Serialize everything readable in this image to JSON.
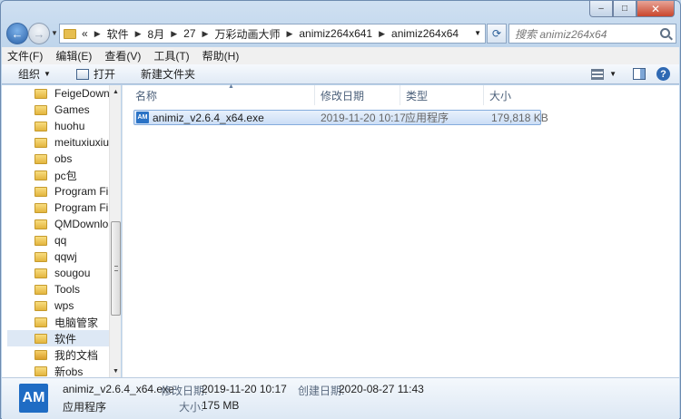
{
  "window": {
    "caption_minimize": "–",
    "caption_maximize": "□",
    "caption_close": "✕"
  },
  "address": {
    "chevron": "«",
    "crumbs": [
      "软件",
      "8月",
      "27",
      "万彩动画大师",
      "animiz264x641",
      "animiz264x64"
    ],
    "search_placeholder": "搜索 animiz264x64"
  },
  "menu": [
    "文件(F)",
    "编辑(E)",
    "查看(V)",
    "工具(T)",
    "帮助(H)"
  ],
  "toolbar": {
    "organize": "组织",
    "open": "打开",
    "new_folder": "新建文件夹",
    "help": "?"
  },
  "navpane": {
    "items": [
      "FeigeDownloa",
      "Games",
      "huohu",
      "meituxiuxiu",
      "obs",
      "pc包",
      "Program Files",
      "Program Files",
      "QMDownload",
      "qq",
      "qqwj",
      "sougou",
      "Tools",
      "wps",
      "电脑管家",
      "软件",
      "我的文档",
      "新obs"
    ],
    "selected_index": 15
  },
  "columns": [
    "名称",
    "修改日期",
    "类型",
    "大小"
  ],
  "files": [
    {
      "icon_text": "AM",
      "name": "animiz_v2.6.4_x64.exe",
      "modified": "2019-11-20 10:17",
      "type": "应用程序",
      "size": "179,818 KB"
    }
  ],
  "details": {
    "icon_text": "AM",
    "filename": "animiz_v2.6.4_x64.exe",
    "type": "应用程序",
    "modified_label": "修改日期:",
    "modified_value": "2019-11-20 10:17",
    "created_label": "创建日期:",
    "created_value": "2020-08-27 11:43",
    "size_label": "大小:",
    "size_value": "175 MB"
  },
  "colors": {
    "accent": "#2b73c6",
    "selection": "#cbdef6",
    "folder": "#e3b53e"
  }
}
